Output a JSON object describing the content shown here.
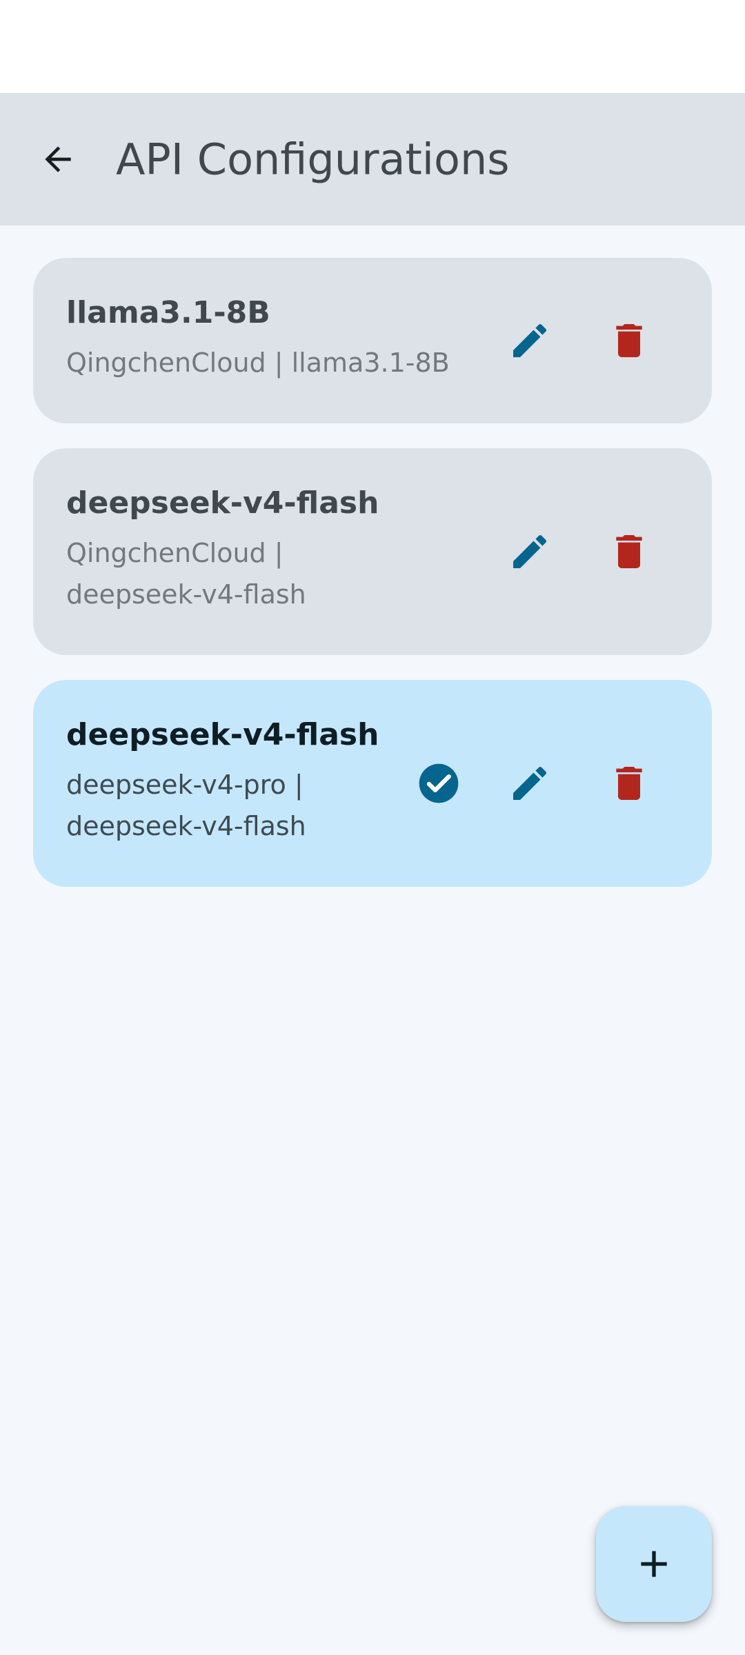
{
  "header": {
    "title": "API Configurations",
    "back_icon": "arrow-back-icon"
  },
  "configs": [
    {
      "title": "llama3.1-8B",
      "subtitle_line1": "QingchenCloud | llama3.1-8B",
      "subtitle_line2": "",
      "active": false
    },
    {
      "title": "deepseek-v4-flash",
      "subtitle_line1": "QingchenCloud |",
      "subtitle_line2": "deepseek-v4-flash",
      "active": false
    },
    {
      "title": "deepseek-v4-flash",
      "subtitle_line1": "deepseek-v4-pro |",
      "subtitle_line2": "deepseek-v4-flash",
      "active": true
    }
  ],
  "colors": {
    "accent": "#05658f",
    "delete": "#b3261e",
    "active_card": "#c5e7fb",
    "card": "#dce2e8"
  },
  "fab": {
    "icon": "plus-icon"
  }
}
